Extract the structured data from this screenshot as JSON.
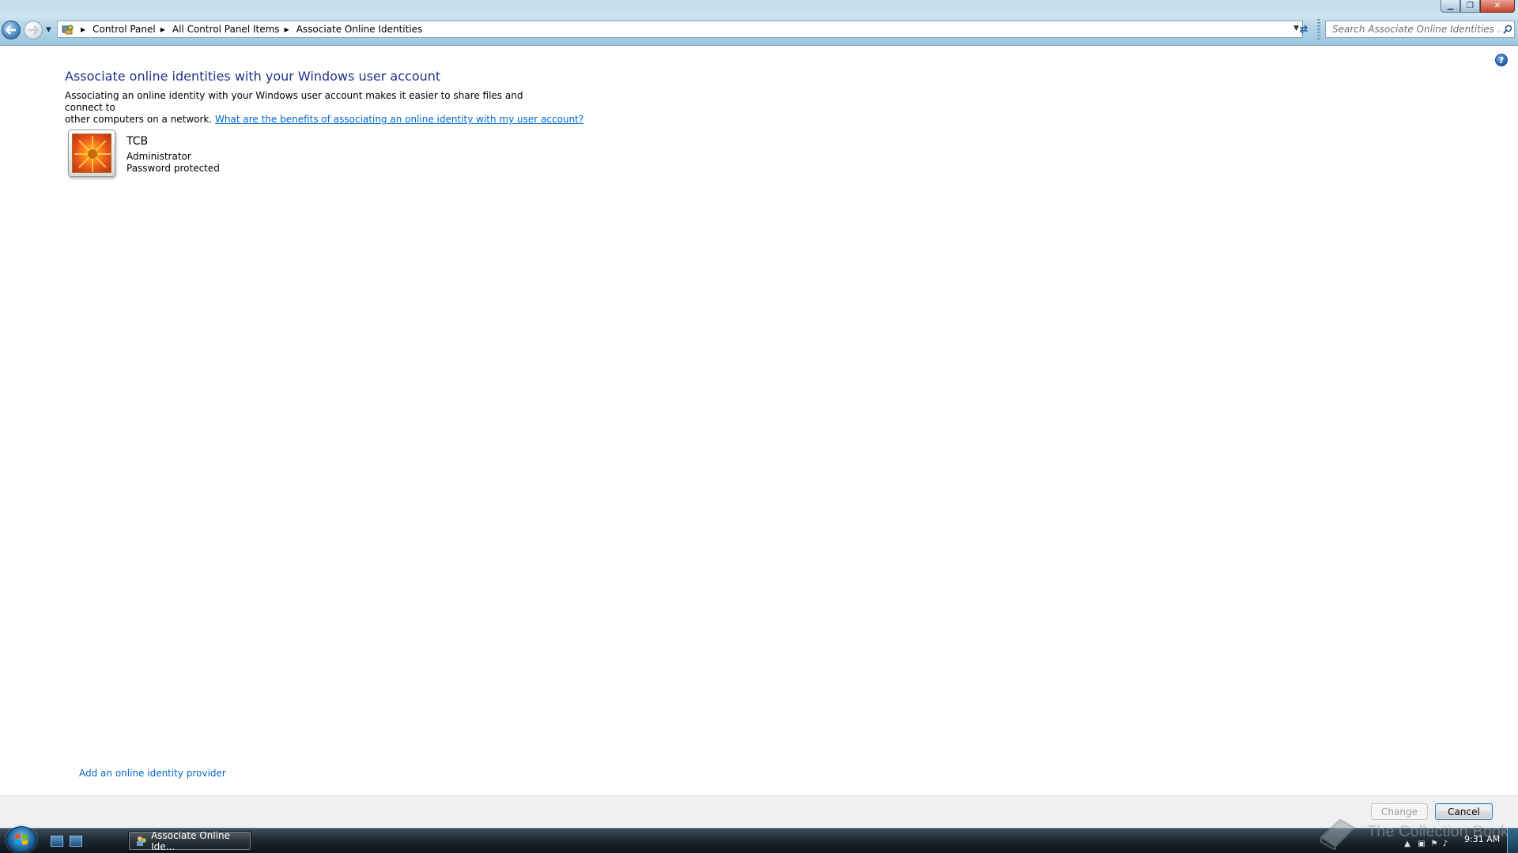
{
  "window": {
    "controls": {
      "minimize": "▁",
      "maximize": "❐",
      "close": "✕"
    }
  },
  "navigation": {
    "back_icon": "back-arrow-icon",
    "forward_icon": "forward-arrow-icon",
    "breadcrumb": [
      "Control Panel",
      "All Control Panel Items",
      "Associate Online Identities"
    ],
    "search_placeholder": "Search Associate Online Identities ..."
  },
  "content": {
    "help_glyph": "?",
    "title": "Associate online identities with your Windows user account",
    "description_line1": "Associating an online identity with your Windows user account makes it easier to share files and connect to",
    "description_line2": "other computers on a network.",
    "benefits_link": "What are the benefits of associating an online identity with my user account?",
    "user": {
      "name": "TCB",
      "role": "Administrator",
      "status": "Password protected"
    },
    "add_provider_link": "Add an online identity provider"
  },
  "buttons": {
    "change": "Change",
    "cancel": "Cancel"
  },
  "taskbar": {
    "active_task": "Associate Online Ide...",
    "clock": "9:31 AM"
  },
  "watermark": "The Collection Book",
  "colors": {
    "title_blue": "#1e3287",
    "link_blue": "#0066cc",
    "taskbar_dark": "#1d2933"
  }
}
